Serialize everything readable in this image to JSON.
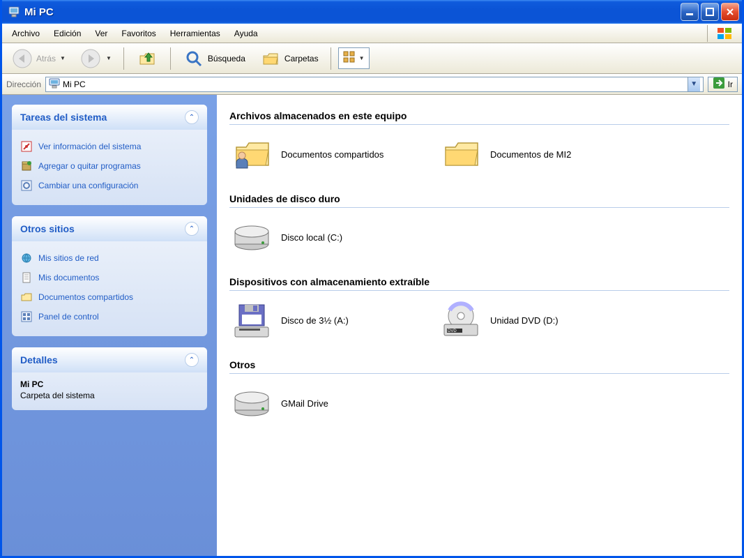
{
  "window": {
    "title": "Mi PC"
  },
  "menubar": {
    "items": [
      "Archivo",
      "Edición",
      "Ver",
      "Favoritos",
      "Herramientas",
      "Ayuda"
    ]
  },
  "toolbar": {
    "back": "Atrás",
    "search": "Búsqueda",
    "folders": "Carpetas"
  },
  "addressbar": {
    "label": "Dirección",
    "value": "Mi PC",
    "go": "Ir"
  },
  "sidebar": {
    "panels": [
      {
        "title": "Tareas del sistema",
        "links": [
          {
            "label": "Ver información del sistema",
            "icon": "info"
          },
          {
            "label": "Agregar o quitar programas",
            "icon": "box"
          },
          {
            "label": "Cambiar una configuración",
            "icon": "gear"
          }
        ]
      },
      {
        "title": "Otros sitios",
        "links": [
          {
            "label": "Mis sitios de red",
            "icon": "network"
          },
          {
            "label": "Mis documentos",
            "icon": "doc"
          },
          {
            "label": "Documentos compartidos",
            "icon": "folder"
          },
          {
            "label": "Panel de control",
            "icon": "panel"
          }
        ]
      },
      {
        "title": "Detalles",
        "details": {
          "name": "Mi PC",
          "type": "Carpeta del sistema"
        }
      }
    ]
  },
  "main": {
    "groups": [
      {
        "header": "Archivos almacenados en este equipo",
        "items": [
          {
            "label": "Documentos compartidos",
            "icon": "shared-folder"
          },
          {
            "label": "Documentos de MI2",
            "icon": "folder"
          }
        ]
      },
      {
        "header": "Unidades de disco duro",
        "items": [
          {
            "label": "Disco local (C:)",
            "icon": "hdd"
          }
        ]
      },
      {
        "header": "Dispositivos con almacenamiento extraíble",
        "items": [
          {
            "label": "Disco de 3½ (A:)",
            "icon": "floppy"
          },
          {
            "label": "Unidad DVD (D:)",
            "icon": "dvd"
          }
        ]
      },
      {
        "header": "Otros",
        "items": [
          {
            "label": "GMail Drive",
            "icon": "hdd"
          }
        ]
      }
    ]
  }
}
